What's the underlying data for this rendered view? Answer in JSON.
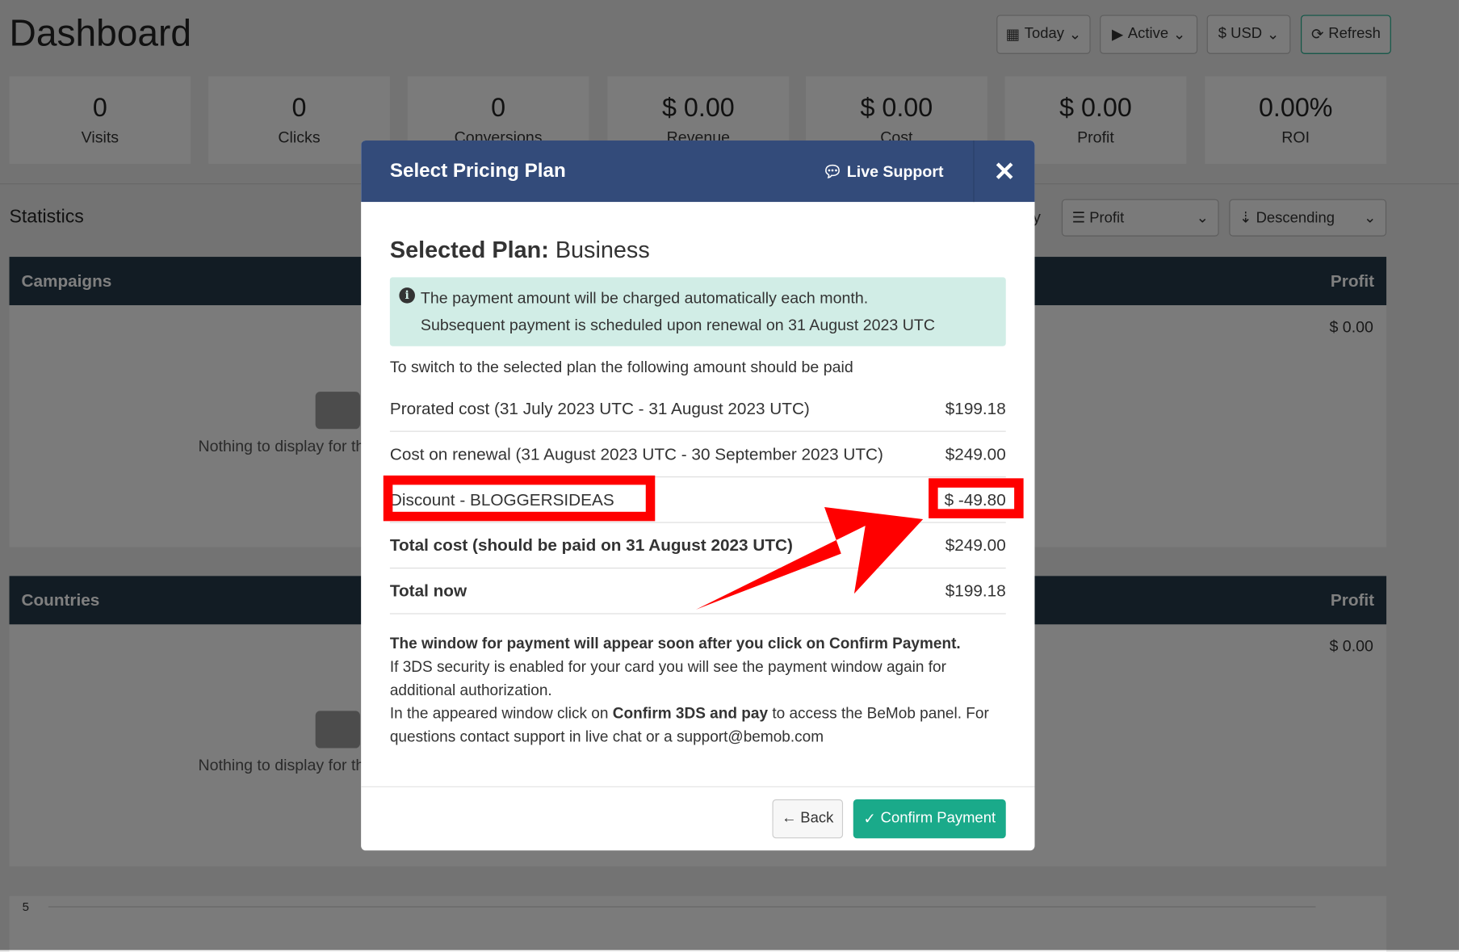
{
  "header": {
    "title": "Dashboard",
    "buttons": [
      {
        "icon": "calendar-icon",
        "label": "Today"
      },
      {
        "icon": "play-icon",
        "label": "Active"
      },
      {
        "icon": "dollar-icon",
        "label": "$ USD"
      },
      {
        "icon": "refresh-icon",
        "label": "Refresh"
      }
    ]
  },
  "stats": [
    {
      "value": "0",
      "label": "Visits"
    },
    {
      "value": "0",
      "label": "Clicks"
    },
    {
      "value": "0",
      "label": "Conversions"
    },
    {
      "value": "$ 0.00",
      "label": "Revenue"
    },
    {
      "value": "$ 0.00",
      "label": "Cost"
    },
    {
      "value": "$ 0.00",
      "label": "Profit"
    },
    {
      "value": "0.00%",
      "label": "ROI"
    }
  ],
  "statistics": {
    "title": "Statistics",
    "sort_field": "Profit",
    "sort_order": "Descending",
    "partial_label": "y"
  },
  "panels": [
    {
      "title": "Campaigns",
      "col": "Profit",
      "value": "$ 0.00",
      "empty": "Nothing to display for th"
    },
    {
      "title": "Countries",
      "col": "Profit",
      "value": "$ 0.00",
      "empty": "Nothing to display for th"
    }
  ],
  "chart": {
    "tick": "5"
  },
  "modal": {
    "title": "Select Pricing Plan",
    "live_support": "Live Support",
    "close": "✕",
    "selected_label": "Selected Plan:",
    "selected_plan": "Business",
    "alert_line1": "The payment amount will be charged automatically each month.",
    "alert_line2": "Subsequent payment is scheduled upon renewal on 31 August 2023 UTC",
    "switch_text": "To switch to the selected plan the following amount should be paid",
    "rows": [
      {
        "label": "Prorated cost (31 July 2023 UTC - 31 August 2023 UTC)",
        "value": "$199.18"
      },
      {
        "label": "Cost on renewal (31 August 2023 UTC - 30 September 2023 UTC)",
        "value": "$249.00"
      },
      {
        "label": "Discount - BLOGGERSIDEAS",
        "value": "$ -49.80"
      },
      {
        "label": "Total cost (should be paid on 31 August 2023 UTC)",
        "value": "$249.00"
      },
      {
        "label": "Total now",
        "value": "$199.18"
      }
    ],
    "note_bold": "The window for payment will appear soon after you click on Confirm Payment.",
    "note1": "If 3DS security is enabled for your card you will see the payment window again for additional authorization.",
    "note2a": "In the appeared window click on ",
    "note2b": "Confirm 3DS and pay",
    "note2c": " to access the BeMob panel. For questions contact support in live chat or a support@bemob.com",
    "back": "Back",
    "confirm": "Confirm Payment"
  },
  "annotation_color": "#ff0000"
}
